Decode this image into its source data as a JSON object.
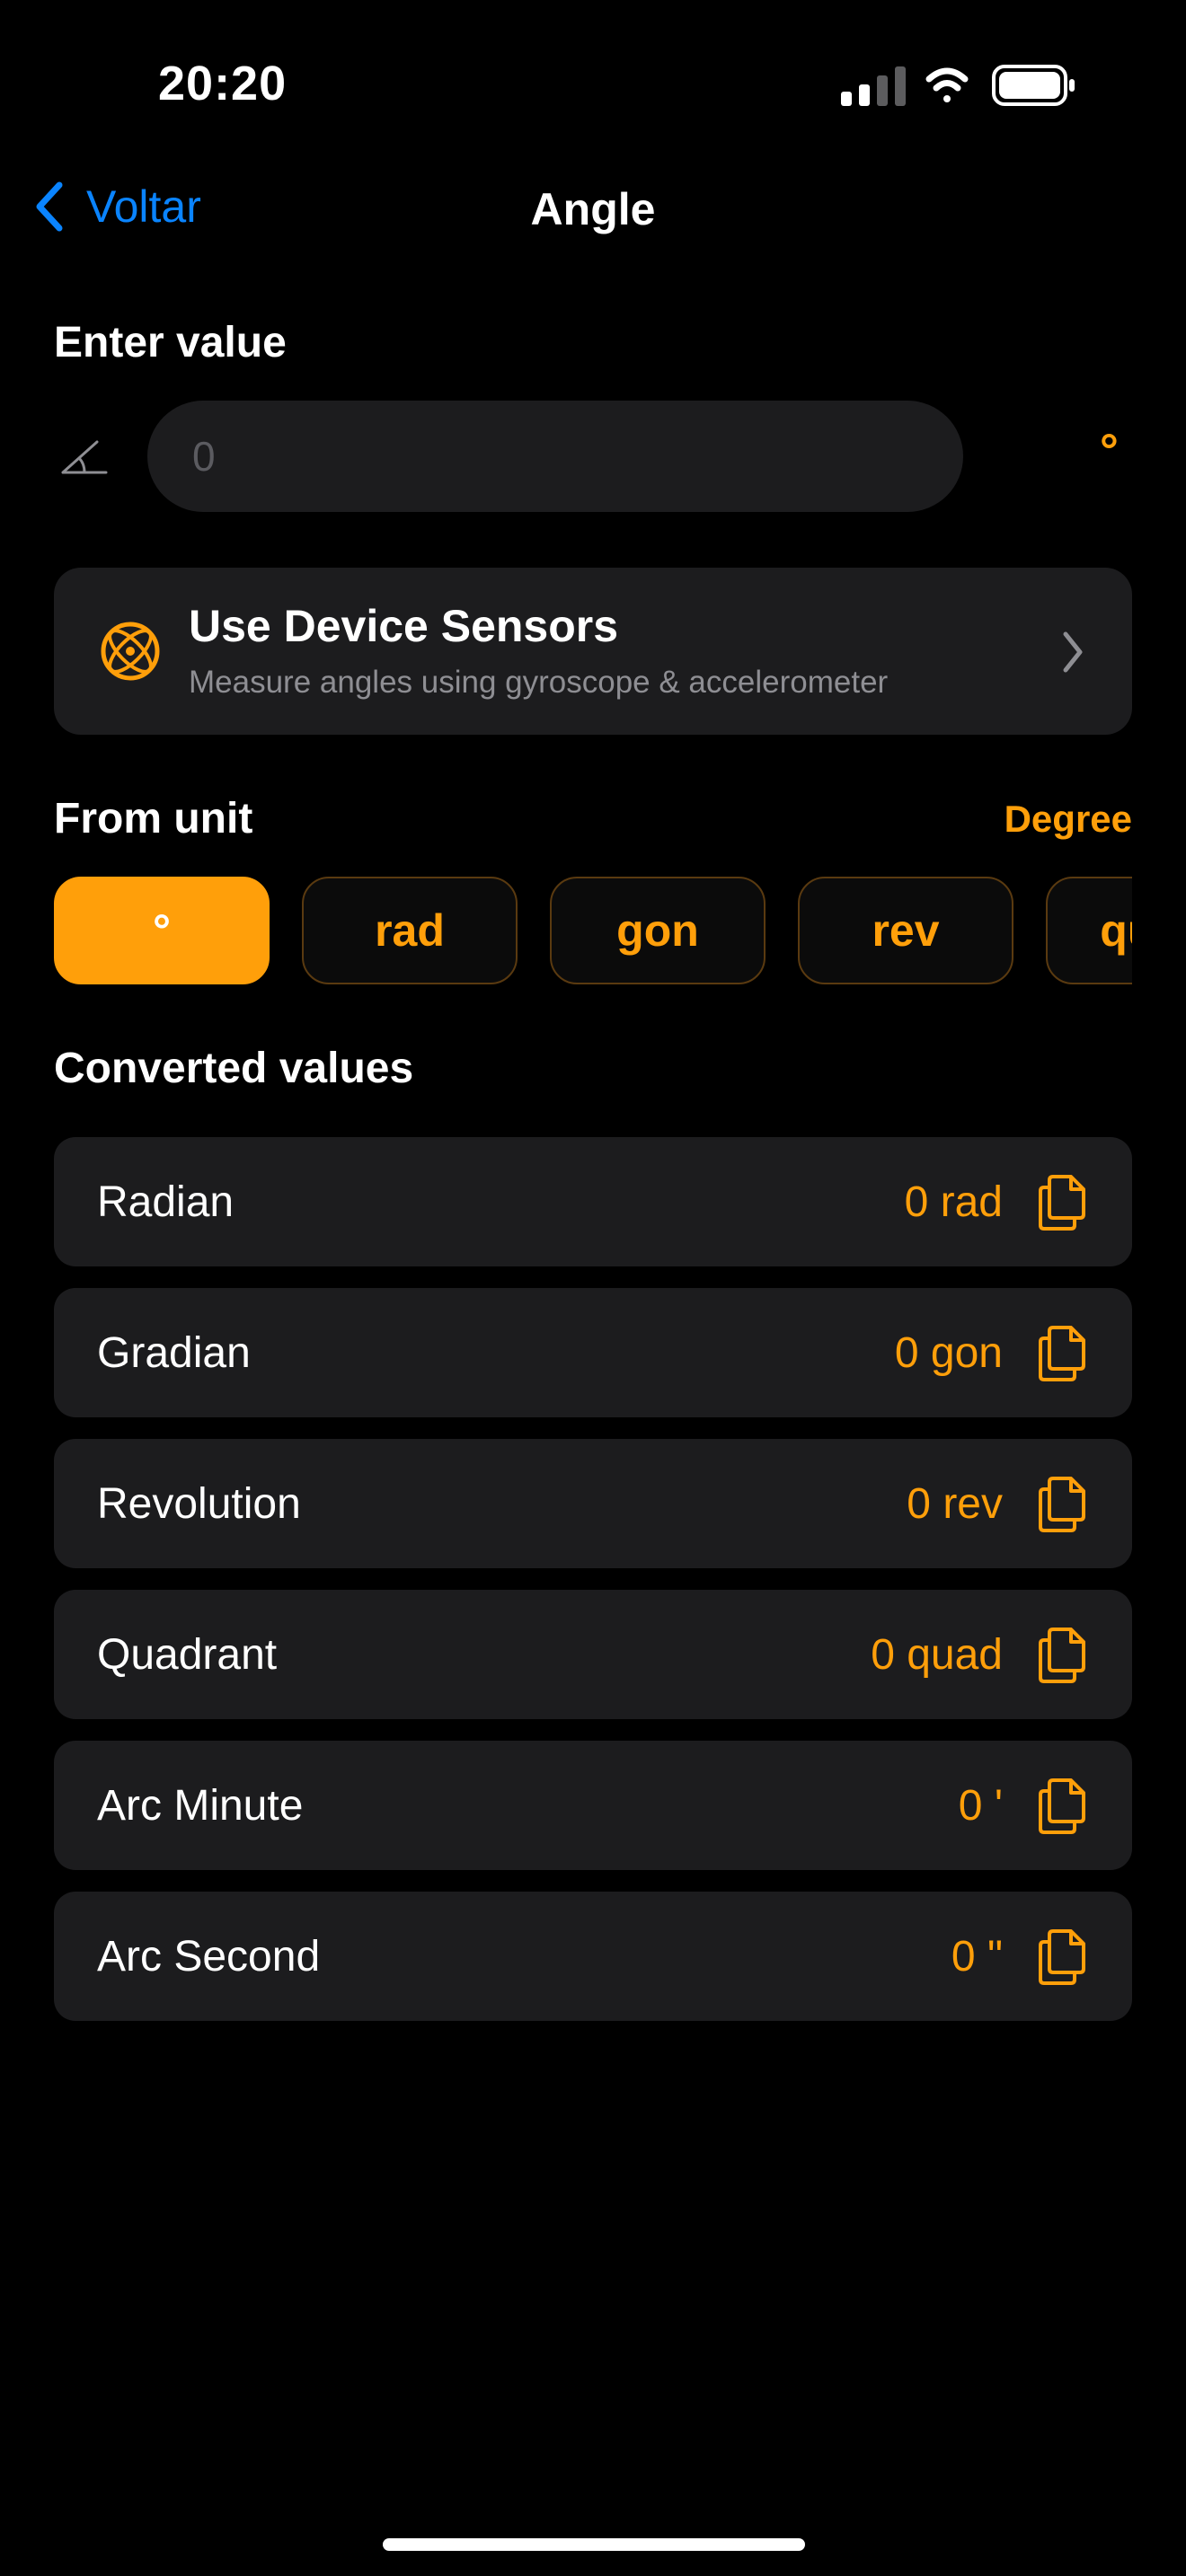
{
  "status_bar": {
    "time": "20:20",
    "icons": [
      "cellular-signal-icon",
      "wifi-icon",
      "battery-icon"
    ]
  },
  "nav": {
    "back_label": "Voltar",
    "title": "Angle"
  },
  "input_section": {
    "title": "Enter value",
    "placeholder": "0",
    "value": "",
    "unit_symbol": "°",
    "icon": "angle-icon"
  },
  "sensors_card": {
    "title": "Use Device Sensors",
    "subtitle": "Measure angles using gyroscope & accelerometer",
    "icon": "gyroscope-icon"
  },
  "from_unit": {
    "title": "From unit",
    "selected_name": "Degree",
    "chips": [
      {
        "label": "°",
        "active": true
      },
      {
        "label": "rad",
        "active": false
      },
      {
        "label": "gon",
        "active": false
      },
      {
        "label": "rev",
        "active": false
      },
      {
        "label": "quad",
        "active": false
      }
    ]
  },
  "converted": {
    "title": "Converted values",
    "rows": [
      {
        "label": "Radian",
        "value": "0 rad"
      },
      {
        "label": "Gradian",
        "value": "0 gon"
      },
      {
        "label": "Revolution",
        "value": "0 rev"
      },
      {
        "label": "Quadrant",
        "value": "0 quad"
      },
      {
        "label": "Arc Minute",
        "value": "0 '"
      },
      {
        "label": "Arc Second",
        "value": "0 \""
      }
    ]
  },
  "colors": {
    "accent": "#FF9F0A",
    "link": "#0A84FF",
    "card": "#1c1c1e",
    "background": "#000000"
  }
}
